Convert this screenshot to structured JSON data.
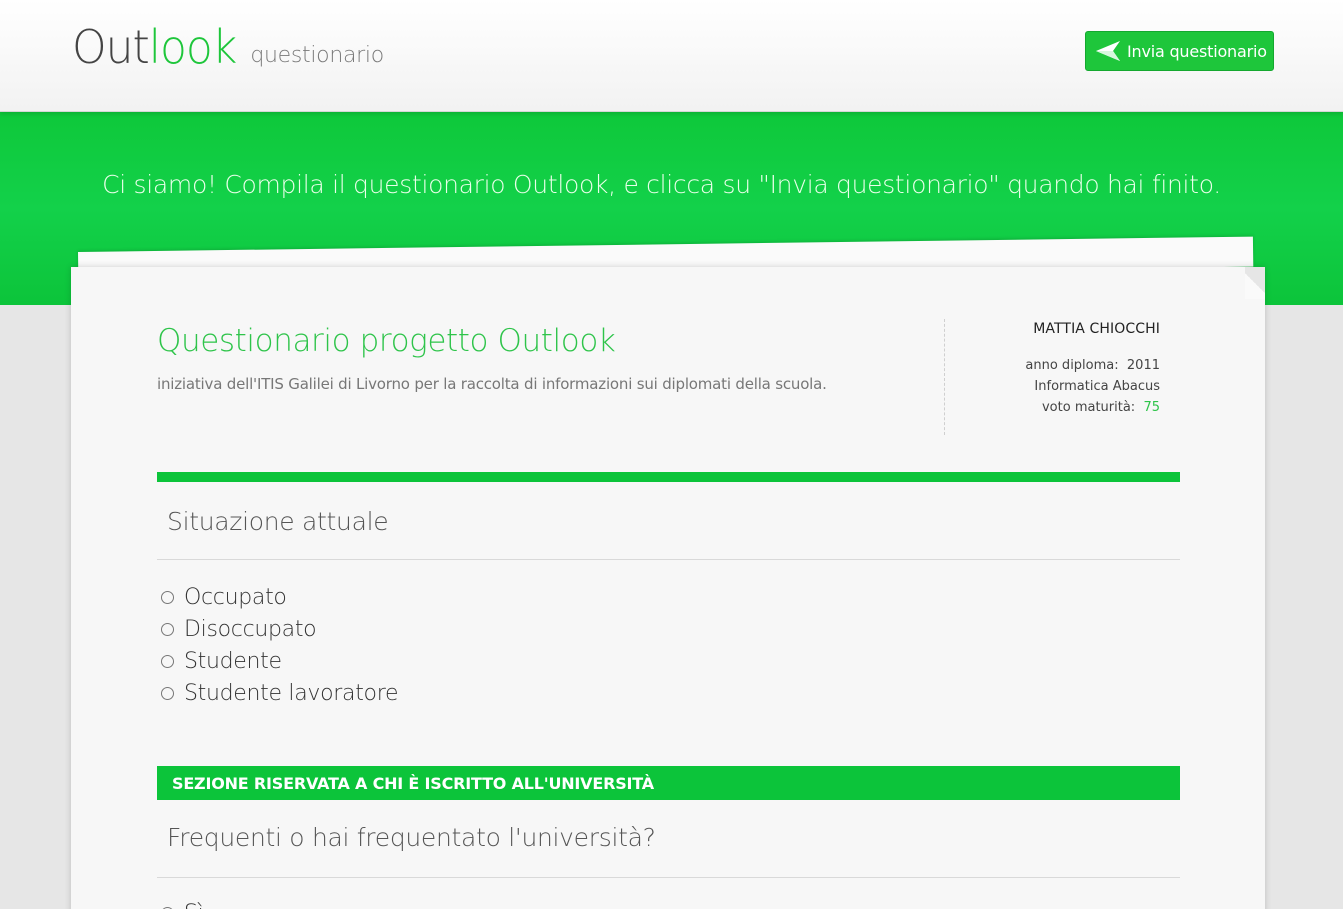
{
  "header": {
    "logo_part1": "Out",
    "logo_part2": "look",
    "subtitle": "questionario",
    "send_button_label": "Invia questionario"
  },
  "banner": {
    "text": "Ci siamo! Compila il questionario Outlook, e clicca su \"Invia questionario\" quando hai finito."
  },
  "survey": {
    "title": "Questionario progetto Outlook",
    "description": "iniziativa dell'ITIS Galilei di Livorno per la raccolta di informazioni sui diplomati della scuola."
  },
  "user": {
    "name": "MATTIA CHIOCCHI",
    "diploma_year_label": "anno diploma:",
    "diploma_year": "2011",
    "course": "Informatica Abacus",
    "grade_label": "voto maturità:",
    "grade": "75"
  },
  "section_current": {
    "title": "Situazione attuale",
    "options": [
      "Occupato",
      "Disoccupato",
      "Studente",
      "Studente lavoratore"
    ]
  },
  "section_university": {
    "banner": "SEZIONE RISERVATA A CHI È ISCRITTO ALL'UNIVERSITÀ",
    "question": "Frequenti o hai frequentato l'università?",
    "options": [
      "Sì"
    ]
  },
  "colors": {
    "accent_green": "#0cc43a",
    "background": "#e6e6e6",
    "paper": "#f7f7f7"
  }
}
